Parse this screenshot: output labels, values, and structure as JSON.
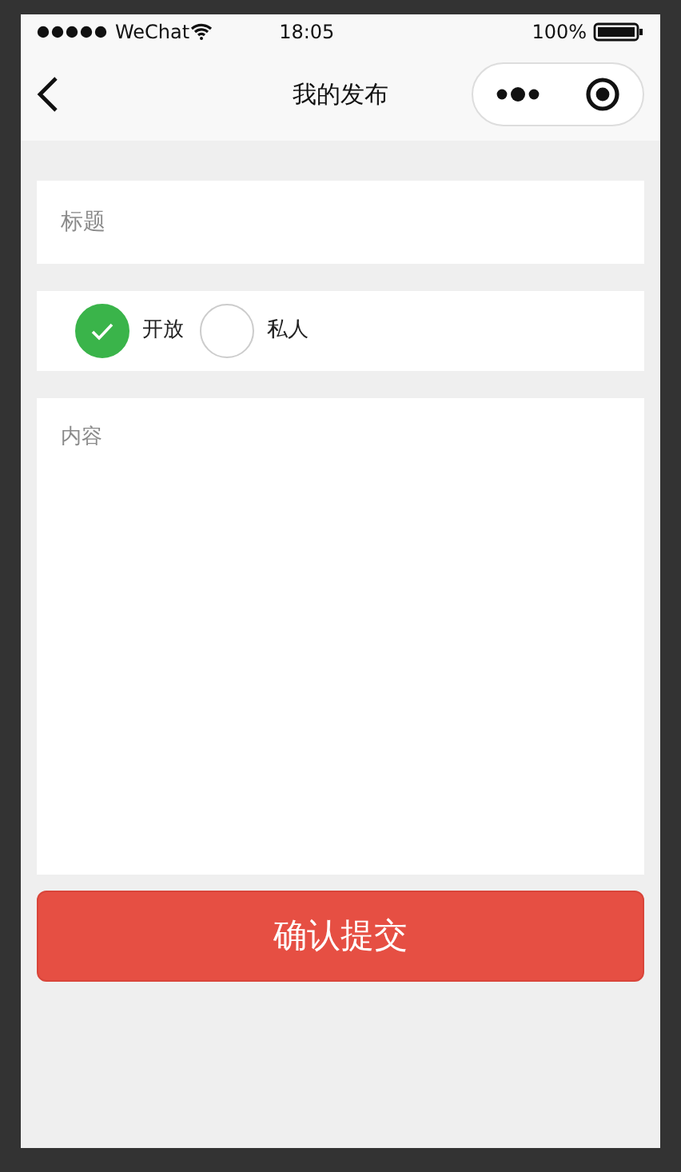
{
  "status_bar": {
    "carrier": "WeChat",
    "time": "18:05",
    "battery": "100%"
  },
  "nav_bar": {
    "title": "我的发布"
  },
  "title_field": {
    "placeholder": "标题"
  },
  "visibility": [
    {
      "label": "开放",
      "selected": true
    },
    {
      "label": "私人",
      "selected": false
    }
  ],
  "content_field": {
    "placeholder": "内容"
  },
  "submit_button": {
    "label": "确认提交"
  }
}
